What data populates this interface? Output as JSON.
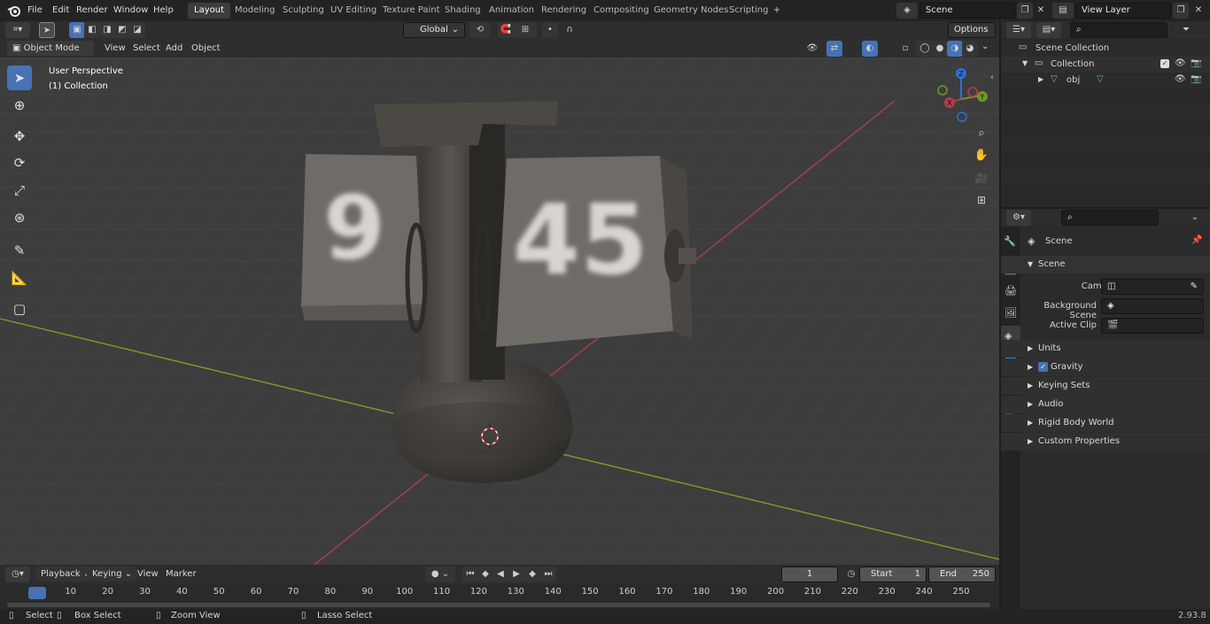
{
  "menu": {
    "file": "File",
    "edit": "Edit",
    "render": "Render",
    "window": "Window",
    "help": "Help"
  },
  "workspaces": [
    "Layout",
    "Modeling",
    "Sculpting",
    "UV Editing",
    "Texture Paint",
    "Shading",
    "Animation",
    "Rendering",
    "Compositing",
    "Geometry Nodes",
    "Scripting"
  ],
  "active_workspace": "Layout",
  "scene_field": "Scene",
  "view_layer_field": "View Layer",
  "toolbar2": {
    "transform_orientation": "Global",
    "options": "Options"
  },
  "viewport_header": {
    "mode": "Object Mode",
    "view": "View",
    "select": "Select",
    "add": "Add",
    "object": "Object"
  },
  "viewport_overlay": {
    "perspective": "User Perspective",
    "collection": "(1) Collection"
  },
  "clock_digits": {
    "left": "9",
    "right": "45"
  },
  "gizmo": {
    "x": "X",
    "y": "Y",
    "z": "Z"
  },
  "outliner": {
    "scene_collection": "Scene Collection",
    "collection": "Collection",
    "obj": "obj"
  },
  "properties": {
    "context": "Scene",
    "panel": "Scene",
    "camera_label": "Camera",
    "background_label": "Background Scene",
    "clip_label": "Active Clip",
    "subpanels": [
      "Units",
      "Gravity",
      "Keying Sets",
      "Audio",
      "Rigid Body World",
      "Custom Properties"
    ],
    "gravity_checked": true
  },
  "timeline": {
    "playback": "Playback",
    "keying": "Keying",
    "view": "View",
    "marker": "Marker",
    "current_frame": "1",
    "start_label": "Start",
    "start": "1",
    "end_label": "End",
    "end": "250",
    "ticks": [
      "1",
      "10",
      "20",
      "30",
      "40",
      "50",
      "60",
      "70",
      "80",
      "90",
      "100",
      "110",
      "120",
      "130",
      "140",
      "150",
      "160",
      "170",
      "180",
      "190",
      "200",
      "210",
      "220",
      "230",
      "240",
      "250"
    ]
  },
  "statusbar": {
    "select": "Select",
    "box_select": "Box Select",
    "zoom_view": "Zoom View",
    "lasso": "Lasso Select",
    "version": "2.93.8"
  },
  "colors": {
    "accent": "#4772b3",
    "x_axis": "#b33d4a",
    "y_axis": "#6b9a24",
    "z_axis": "#2f6fd4"
  }
}
